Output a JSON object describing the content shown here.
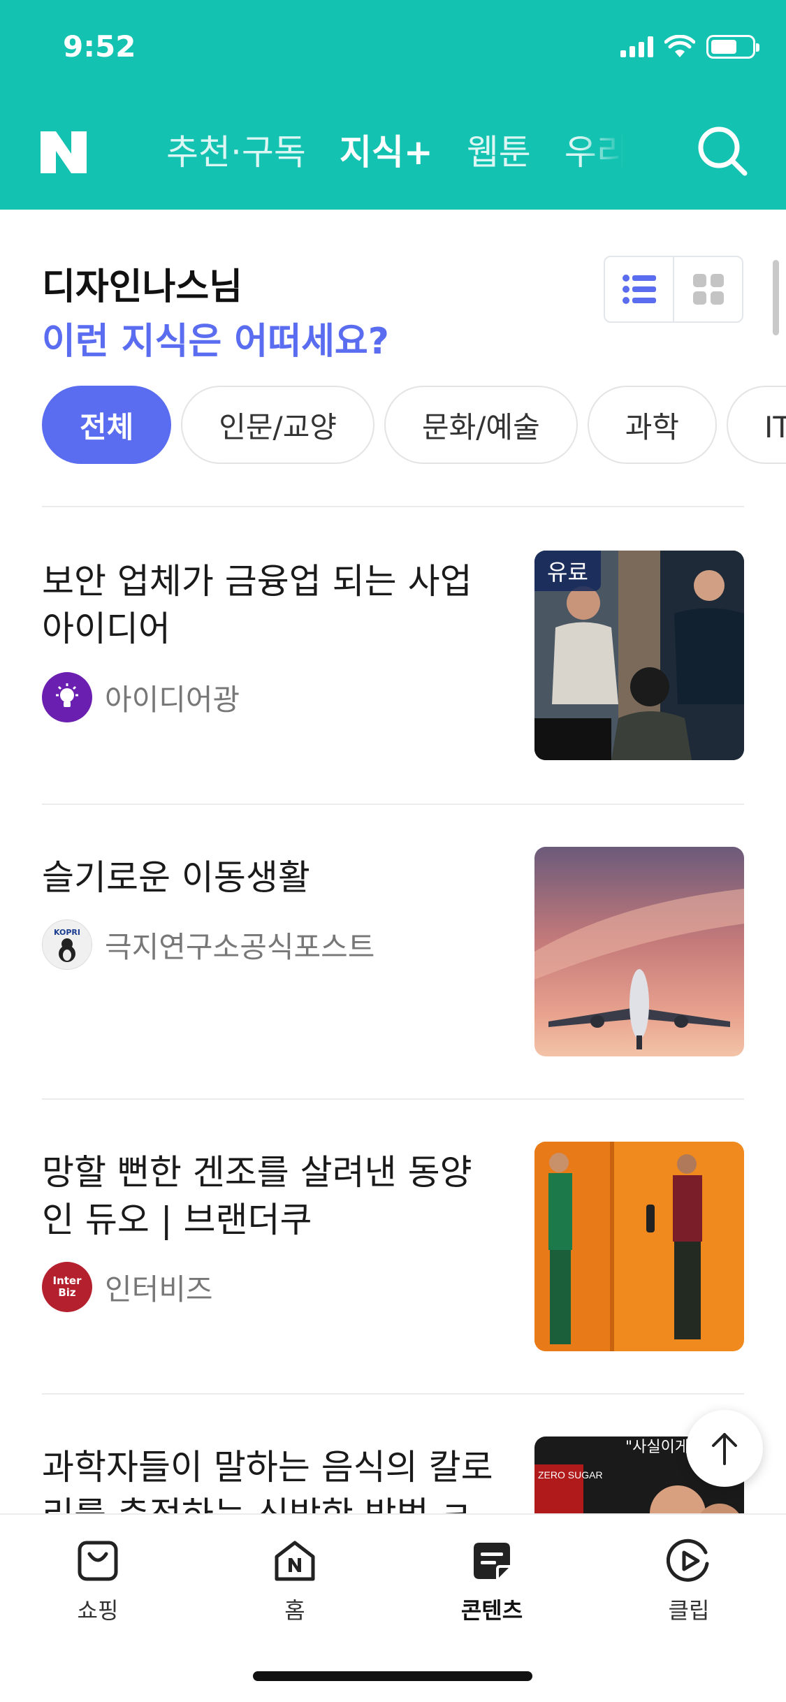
{
  "status_bar": {
    "time": "9:52"
  },
  "top_nav": {
    "logo": "N",
    "tabs": [
      {
        "label": "추천·구독",
        "active": false
      },
      {
        "label": "지식+",
        "active": true
      },
      {
        "label": "웹툰",
        "active": false
      },
      {
        "label": "우리동",
        "active": false
      }
    ],
    "search_icon": "search-icon"
  },
  "section": {
    "greeting": "디자인나스님",
    "subtitle": "이런 지식은 어떠세요?",
    "view_modes": [
      "list-view-icon",
      "grid-view-icon"
    ],
    "active_view": "list"
  },
  "categories": [
    {
      "label": "전체",
      "active": true
    },
    {
      "label": "인문/교양",
      "active": false
    },
    {
      "label": "문화/예술",
      "active": false
    },
    {
      "label": "과학",
      "active": false
    },
    {
      "label": "IT/테",
      "active": false
    }
  ],
  "articles": [
    {
      "title": "보안 업체가 금융업 되는 사업 아이디어",
      "source": "아이디어광",
      "badge": "유료",
      "avatar_icon": "lightbulb-icon"
    },
    {
      "title": "슬기로운 이동생활",
      "source": "극지연구소공식포스트",
      "avatar_text": "KOPRI"
    },
    {
      "title": "망할 뻔한 겐조를 살려낸 동양인 듀오 | 브랜더쿠",
      "source": "인터비즈",
      "avatar_text": "Inter Biz"
    },
    {
      "title": "과학자들이 말하는 음식의 칼로리를 측정하는 신박한 방법 ㅋㅋ",
      "thumb_text": "\"사실이게..\"",
      "thumb_sub": "ZERO SUGAR"
    }
  ],
  "bottom_nav": [
    {
      "label": "쇼핑",
      "icon": "shopping-bag-icon",
      "active": false
    },
    {
      "label": "홈",
      "icon": "home-icon",
      "active": false
    },
    {
      "label": "콘텐츠",
      "icon": "contents-icon",
      "active": true
    },
    {
      "label": "클립",
      "icon": "clip-icon",
      "active": false
    }
  ],
  "colors": {
    "brand": "#13c2b0",
    "accent": "#5a6cf0"
  }
}
